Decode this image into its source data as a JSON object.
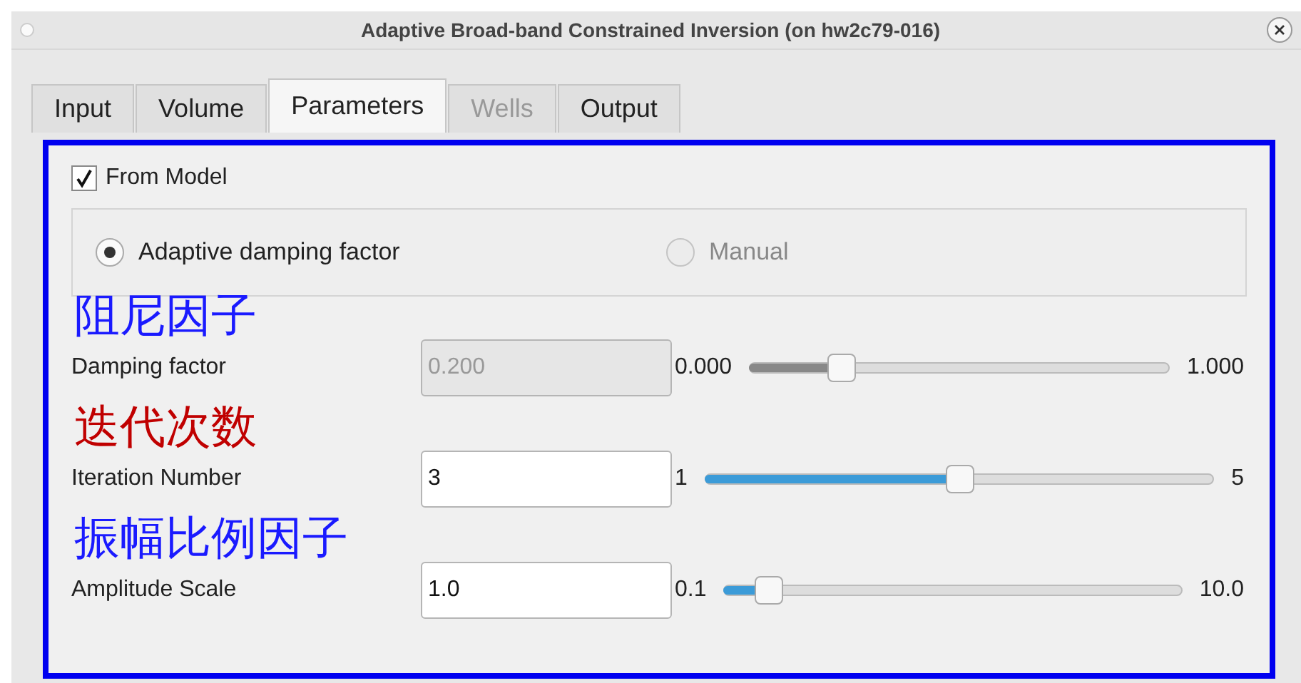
{
  "window": {
    "title": "Adaptive Broad-band Constrained Inversion (on hw2c79-016)"
  },
  "tabs": [
    {
      "label": "Input",
      "selected": false,
      "disabled": false
    },
    {
      "label": "Volume",
      "selected": false,
      "disabled": false
    },
    {
      "label": "Parameters",
      "selected": true,
      "disabled": false
    },
    {
      "label": "Wells",
      "selected": false,
      "disabled": true
    },
    {
      "label": "Output",
      "selected": false,
      "disabled": false
    }
  ],
  "from_model": {
    "label": "From Model",
    "checked": true
  },
  "radios": [
    {
      "label": "Adaptive damping factor",
      "selected": true,
      "disabled": false
    },
    {
      "label": "Manual",
      "selected": false,
      "disabled": true
    }
  ],
  "params": [
    {
      "annotation": "阻尼因子",
      "color": "#1a1aff",
      "label": "Damping factor",
      "value": "0.200",
      "disabled": true,
      "min": "0.000",
      "max": "1.000",
      "level": 0.22
    },
    {
      "annotation": "迭代次数",
      "color": "#c00000",
      "label": "Iteration Number",
      "value": "3",
      "disabled": false,
      "min": "1",
      "max": "5",
      "level": 0.5
    },
    {
      "annotation": "振幅比例因子",
      "color": "#1a1aff",
      "label": "Amplitude Scale",
      "value": "1.0",
      "disabled": false,
      "min": "0.1",
      "max": "10.0",
      "level": 0.1
    }
  ]
}
